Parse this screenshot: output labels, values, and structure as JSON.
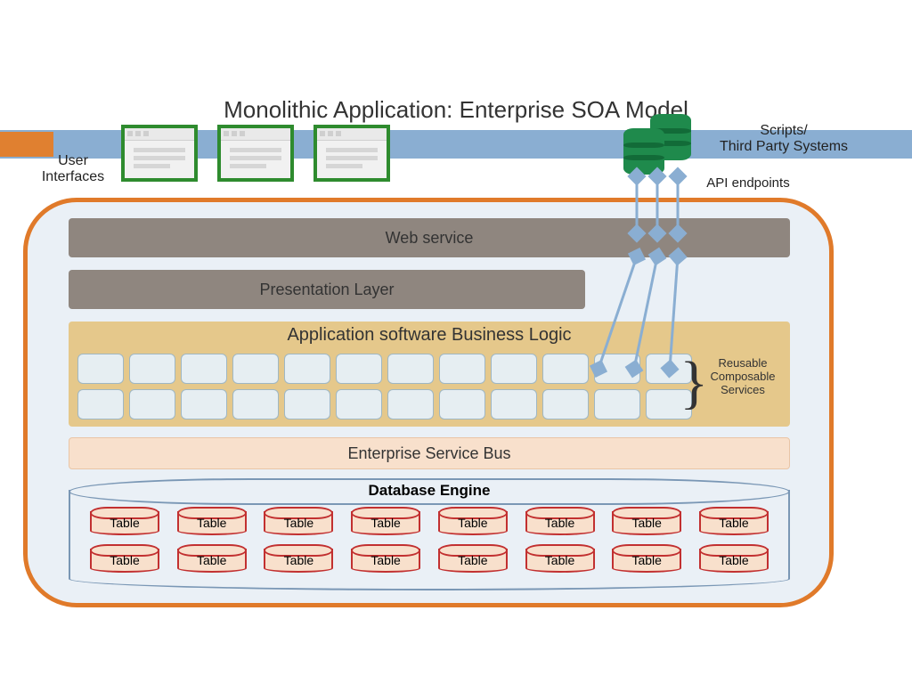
{
  "title": "Monolithic Application: Enterprise SOA Model",
  "captions": {
    "user_interfaces": "User\nInterfaces",
    "scripts": "Scripts/\nThird Party Systems",
    "api_endpoints": "API endpoints"
  },
  "layers": {
    "web_service": "Web service",
    "presentation": "Presentation Layer",
    "business_logic": "Application software Business Logic",
    "reusable_services": "Reusable\nComposable\nServices",
    "esb": "Enterprise Service Bus",
    "database_engine": "Database Engine"
  },
  "business_logic_grid": {
    "rows": 2,
    "cols": 12
  },
  "table_rows": [
    [
      "Table",
      "Table",
      "Table",
      "Table",
      "Table",
      "Table",
      "Table",
      "Table"
    ],
    [
      "Table",
      "Table",
      "Table",
      "Table",
      "Table",
      "Table",
      "Table",
      "Table"
    ]
  ],
  "colors": {
    "band": "#8aaed2",
    "orange": "#e07a2a",
    "brownLayer": "#8f867f",
    "tan": "#e5c88b",
    "esb": "#f8e0cc",
    "green": "#1f8a4c",
    "red": "#c23030"
  }
}
